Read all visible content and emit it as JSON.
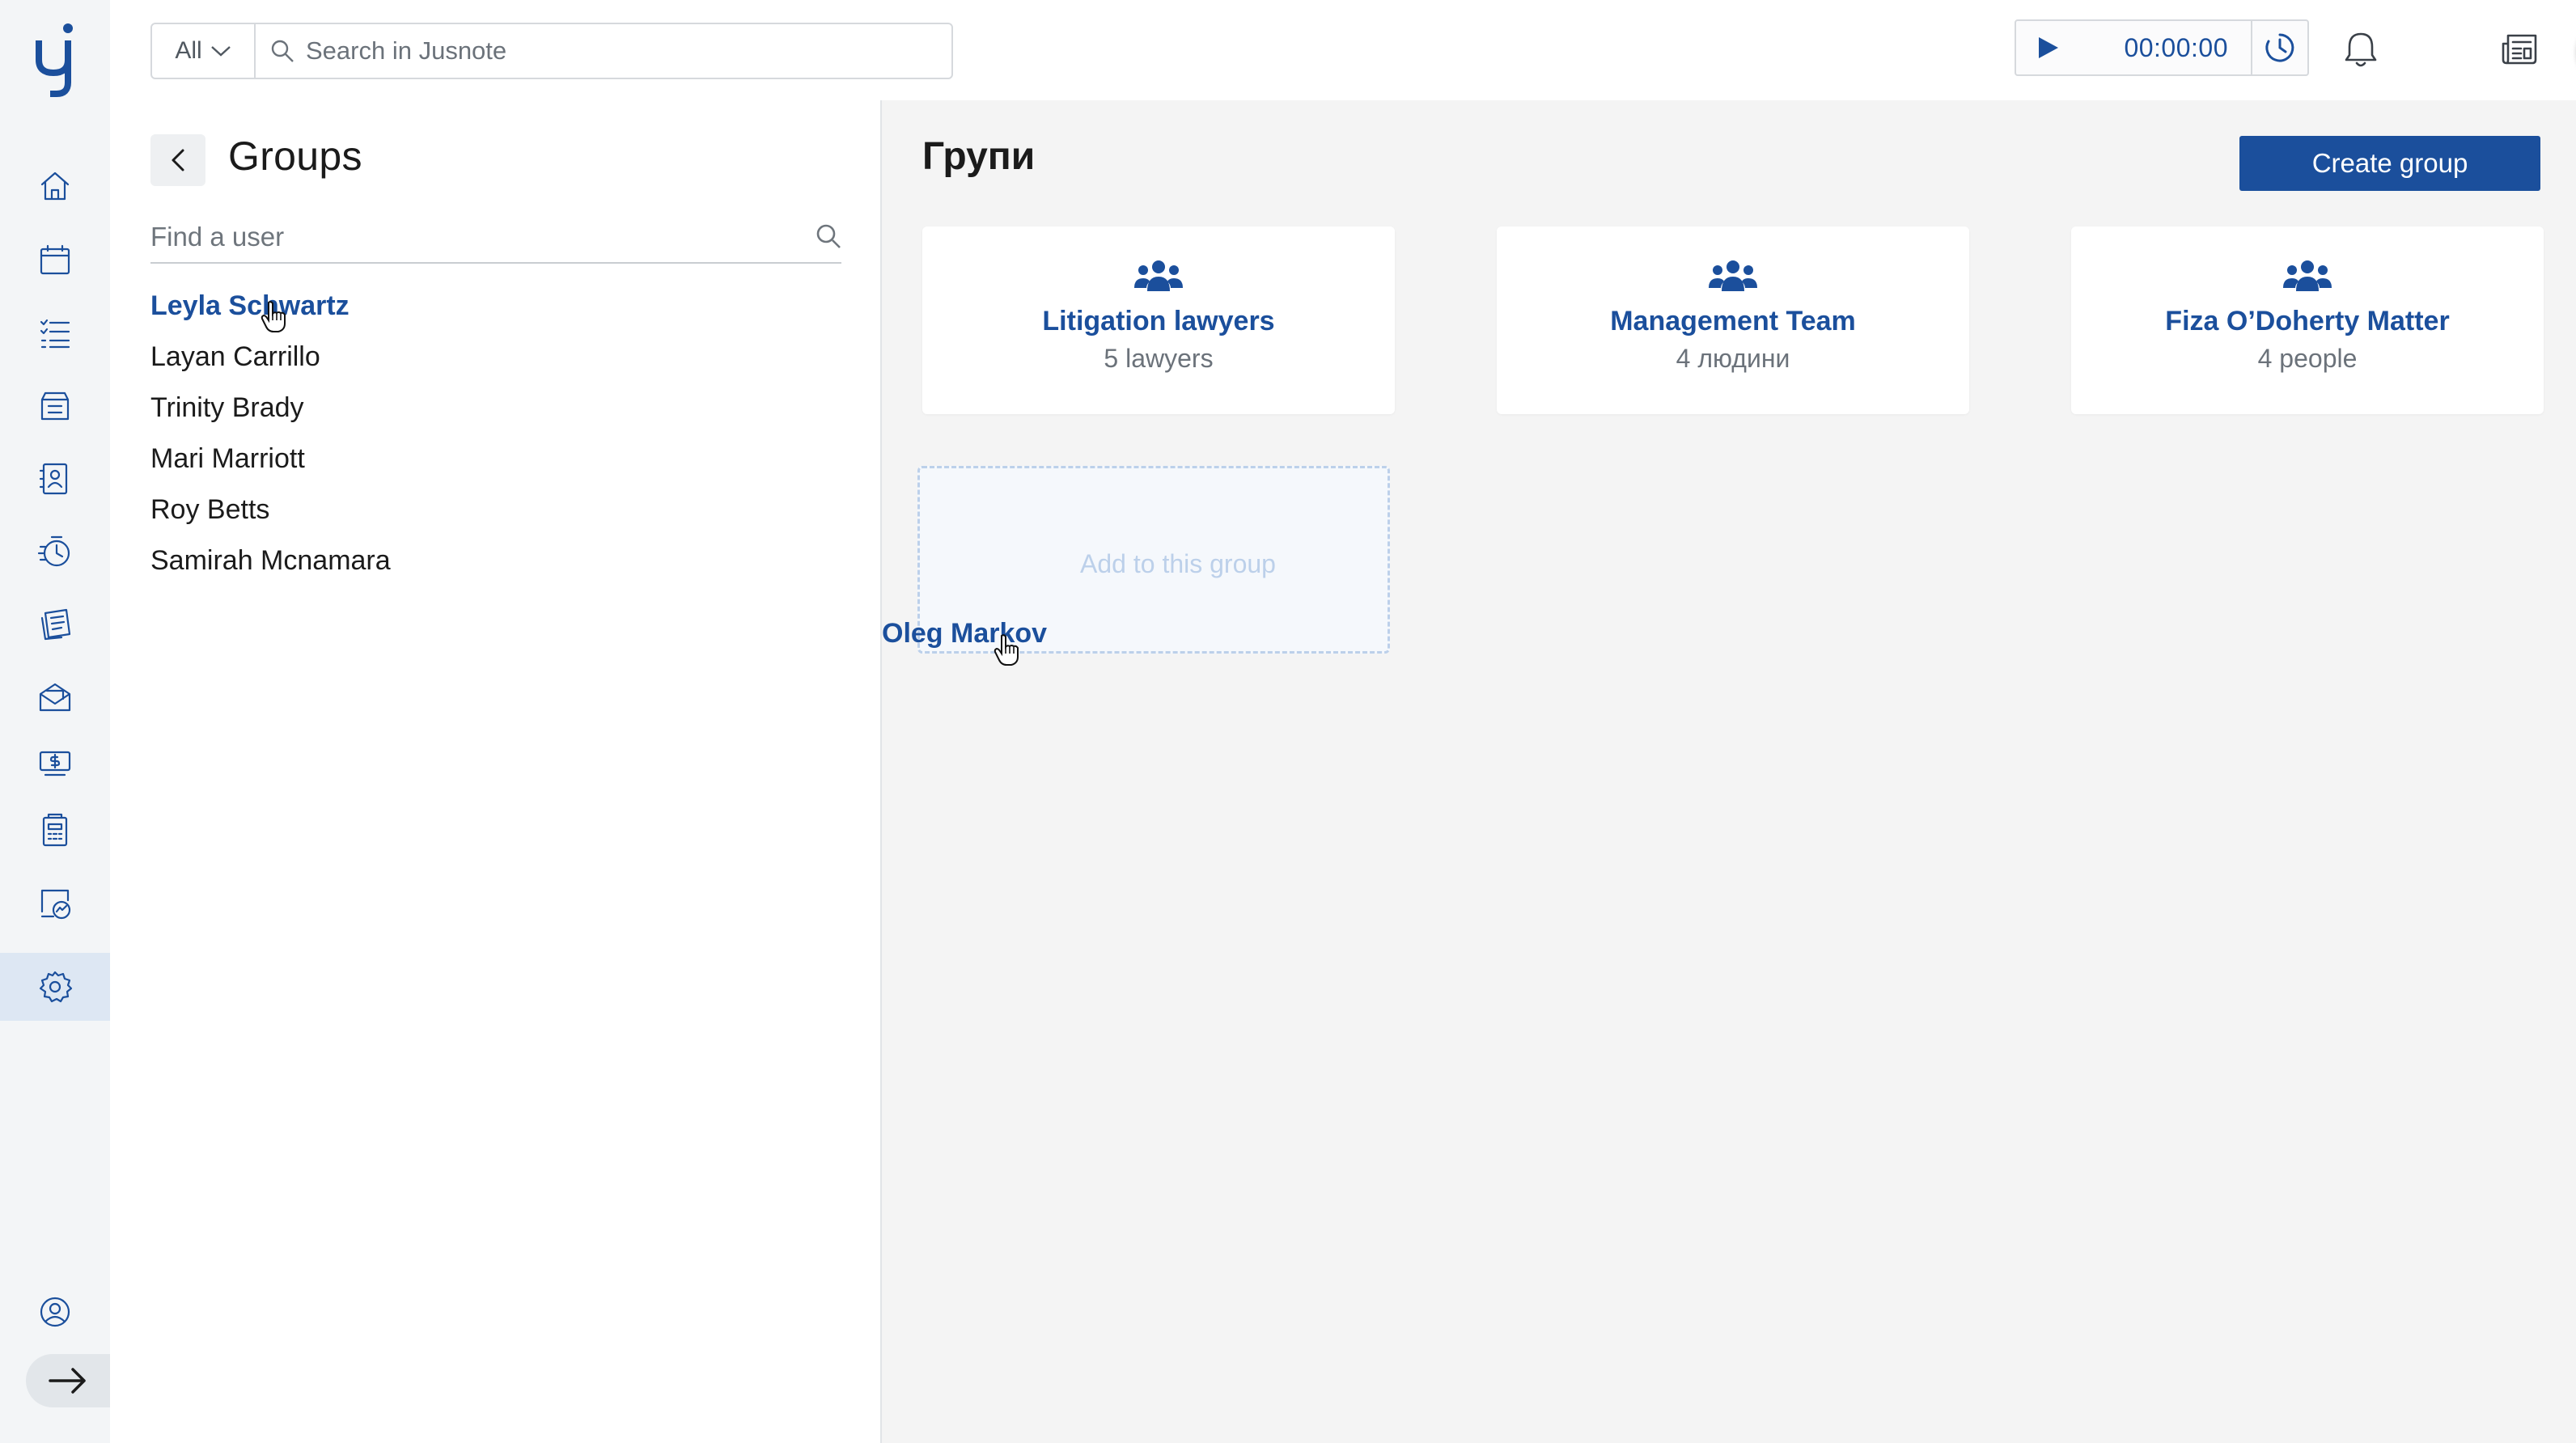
{
  "app": {
    "brand": "Jusnote",
    "accent_color": "#1b4f9c",
    "success_color": "#1e9e6c"
  },
  "topbar": {
    "search_scope": "All",
    "search_placeholder": "Search in Jusnote",
    "timer_value": "00:00:00"
  },
  "nav": {
    "items": [
      {
        "icon": "home-icon"
      },
      {
        "icon": "calendar-icon"
      },
      {
        "icon": "tasks-icon"
      },
      {
        "icon": "matters-icon"
      },
      {
        "icon": "contacts-icon"
      },
      {
        "icon": "time-tracking-icon"
      },
      {
        "icon": "bills-icon"
      },
      {
        "icon": "mail-icon"
      },
      {
        "icon": "payments-icon"
      },
      {
        "icon": "accounting-icon"
      },
      {
        "icon": "reports-icon"
      },
      {
        "icon": "settings-icon",
        "active": true
      }
    ],
    "bottom": [
      {
        "icon": "profile-icon"
      },
      {
        "icon": "expand-arrow-icon"
      }
    ]
  },
  "left_panel": {
    "title": "Groups",
    "user_search_placeholder": "Find a user",
    "users": [
      {
        "name": "Leyla Schwartz",
        "selected": true
      },
      {
        "name": "Layan Carrillo"
      },
      {
        "name": "Trinity Brady"
      },
      {
        "name": "Mari Marriott"
      },
      {
        "name": "Roy Betts"
      },
      {
        "name": "Samirah Mcnamara"
      }
    ]
  },
  "main": {
    "title": "Групи",
    "create_button": "Create group",
    "groups": [
      {
        "name": "Litigation lawyers",
        "count": "5 lawyers"
      },
      {
        "name": "Management Team",
        "count": "4 людини"
      },
      {
        "name": "Fiza O’Doherty Matter",
        "count": "4 people"
      }
    ],
    "drop_zone_text": "Add to this group",
    "dragged_user": "Oleg Markov"
  }
}
